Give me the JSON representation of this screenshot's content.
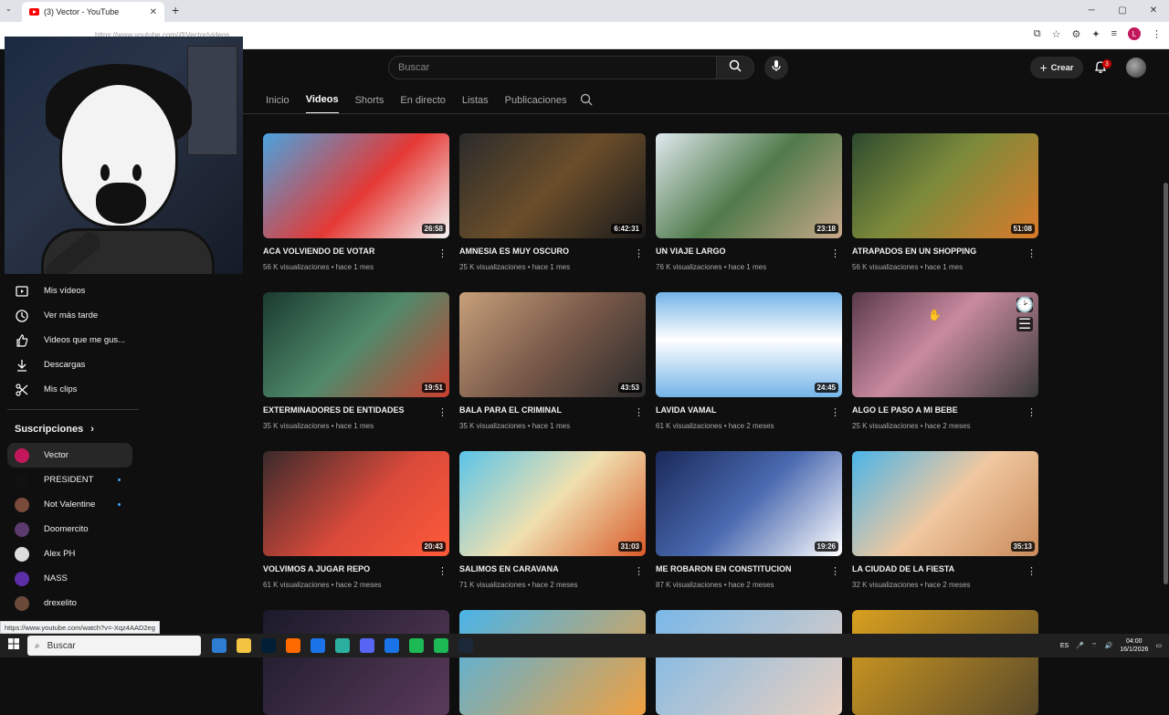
{
  "browser": {
    "tab_title": "(3) Vector - YouTube",
    "url": "https://www.youtube.com/@Vector/videos"
  },
  "masthead": {
    "search_placeholder": "Buscar",
    "create_label": "Crear",
    "notification_count": "3"
  },
  "channel_tabs": [
    "Inicio",
    "Videos",
    "Shorts",
    "En directo",
    "Listas",
    "Publicaciones"
  ],
  "active_tab": "Videos",
  "sidebar": {
    "items": [
      {
        "label": "Mis vídeos",
        "icon": "my-videos-icon"
      },
      {
        "label": "Ver más tarde",
        "icon": "watch-later-icon"
      },
      {
        "label": "Videos que me gus...",
        "icon": "thumbs-up-icon"
      },
      {
        "label": "Descargas",
        "icon": "download-icon"
      },
      {
        "label": "Mis clips",
        "icon": "scissors-icon"
      }
    ],
    "subscriptions_heading": "Suscripciones",
    "subscriptions": [
      {
        "name": "Vector",
        "color": "#c2185b",
        "new": false,
        "active": true
      },
      {
        "name": "PRESIDENT",
        "color": "#111111",
        "new": true,
        "active": false
      },
      {
        "name": "Not Valentine",
        "color": "#7a4a3a",
        "new": true,
        "active": false
      },
      {
        "name": "Doomercito",
        "color": "#5b3a6e",
        "new": false,
        "active": false
      },
      {
        "name": "Alex PH",
        "color": "#dddddd",
        "new": false,
        "active": false
      },
      {
        "name": "NASS",
        "color": "#5c2ea8",
        "new": false,
        "active": false
      },
      {
        "name": "drexelito",
        "color": "#6b4a3a",
        "new": false,
        "active": false
      }
    ]
  },
  "videos": [
    {
      "title": "ACA VOLVIENDO DE VOTAR",
      "meta": "56 K visualizaciones • hace 1 mes",
      "duration": "26:58",
      "bg": "linear-gradient(135deg,#4aa3df 0%,#e53935 55%,#f5f5f5 100%)"
    },
    {
      "title": "AMNESIA ES MUY OSCURO",
      "meta": "25 K visualizaciones • hace 1 mes",
      "duration": "6:42:31",
      "bg": "linear-gradient(135deg,#2b2b2b 0%,#6b4e2a 50%,#1a1a1a 100%)"
    },
    {
      "title": "UN VIAJE LARGO",
      "meta": "76 K visualizaciones • hace 1 mes",
      "duration": "23:18",
      "bg": "linear-gradient(135deg,#dfe9ee 0%,#4f7a4a 50%,#c9a98a 100%)"
    },
    {
      "title": "ATRAPADOS EN UN SHOPPING",
      "meta": "56 K visualizaciones • hace 1 mes",
      "duration": "51:08",
      "bg": "linear-gradient(135deg,#2d4a2f 0%,#7c8b3a 45%,#d97a2a 100%)"
    },
    {
      "title": "EXTERMINADORES DE ENTIDADES",
      "meta": "35 K visualizaciones • hace 1 mes",
      "duration": "19:51",
      "bg": "linear-gradient(135deg,#1a3a2f 0%,#4f8a6a 50%,#c94030 100%)"
    },
    {
      "title": "BALA PARA EL CRIMINAL",
      "meta": "35 K visualizaciones • hace 1 mes",
      "duration": "43:53",
      "bg": "linear-gradient(135deg,#c7a07a 0%,#7a5a4a 50%,#2a2a2a 100%)"
    },
    {
      "title": "LAVIDA VAMAL",
      "meta": "61 K visualizaciones • hace 2 meses",
      "duration": "24:45",
      "bg": "linear-gradient(180deg,#74b4e8 0%,#ffffff 45%,#74b4e8 100%)"
    },
    {
      "title": "ALGO LE PASO A MI BEBE",
      "meta": "25 K visualizaciones • hace 2 meses",
      "duration": "",
      "bg": "linear-gradient(135deg,#5a3a4a 0%,#c98aa0 45%,#3a3a3a 100%)"
    },
    {
      "title": "VOLVIMOS A JUGAR REPO",
      "meta": "61 K visualizaciones • hace 2 meses",
      "duration": "20:43",
      "bg": "linear-gradient(135deg,#3a2a2a 0%,#d94a3a 55%,#ff5a3a 100%)"
    },
    {
      "title": "SALIMOS EN CARAVANA",
      "meta": "71 K visualizaciones • hace 2 meses",
      "duration": "31:03",
      "bg": "linear-gradient(135deg,#5ac4e8 0%,#f0e0b0 50%,#d95a2a 100%)"
    },
    {
      "title": "ME ROBARON EN CONSTITUCION",
      "meta": "87 K visualizaciones • hace 2 meses",
      "duration": "19:26",
      "bg": "linear-gradient(135deg,#1a2a5a 0%,#4a6ab0 50%,#ffffff 100%)"
    },
    {
      "title": "LA CIUDAD DE LA FIESTA",
      "meta": "32 K visualizaciones • hace 2 meses",
      "duration": "35:13",
      "bg": "linear-gradient(135deg,#4ab4e8 0%,#f0c8a0 50%,#c98a5a 100%)"
    },
    {
      "title": "",
      "meta": "",
      "duration": "",
      "bg": "linear-gradient(135deg,#1a1a2a 0%,#5a3a5a 100%)"
    },
    {
      "title": "",
      "meta": "",
      "duration": "",
      "bg": "linear-gradient(135deg,#4ab4e8 0%,#f0a040 100%)"
    },
    {
      "title": "",
      "meta": "",
      "duration": "",
      "bg": "linear-gradient(135deg,#7ab8e8 0%,#e8d0c0 100%)"
    },
    {
      "title": "",
      "meta": "",
      "duration": "",
      "bg": "linear-gradient(135deg,#d9a020 0%,#5a4a2a 100%)"
    }
  ],
  "status_link": "https://www.youtube.com/watch?v=-Xqz4AAD2eg",
  "taskbar": {
    "search_label": "Buscar",
    "lang": "ES",
    "time": "04:00",
    "date": "16/1/2026",
    "apps": [
      "#2d7dd2",
      "#f4c542",
      "#001e36",
      "#ff6a00",
      "#1a73e8",
      "#2bb0a0",
      "#5865f2",
      "#1a73e8",
      "#1db954",
      "#1db954",
      "#1b2838"
    ]
  }
}
